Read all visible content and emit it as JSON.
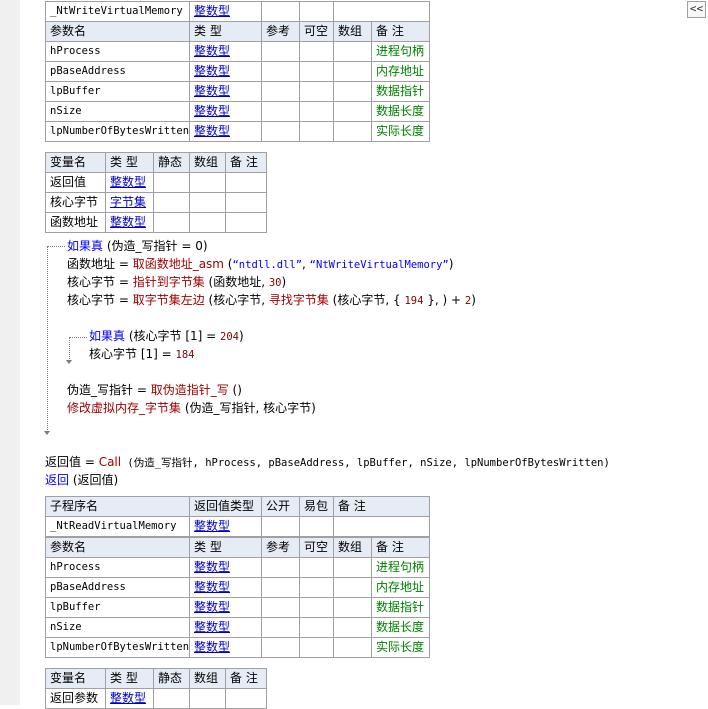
{
  "ui": {
    "collapse_glyph": "<<"
  },
  "sub1": {
    "name": "_NtWriteVirtualMemory",
    "ret_type": "整数型",
    "param_header": [
      "参数名",
      "类 型",
      "参考",
      "可空",
      "数组",
      "备 注"
    ],
    "params": [
      {
        "name": "hProcess",
        "type": "整数型",
        "note": "进程句柄"
      },
      {
        "name": "pBaseAddress",
        "type": "整数型",
        "note": "内存地址"
      },
      {
        "name": "lpBuffer",
        "type": "整数型",
        "note": "数据指针"
      },
      {
        "name": "nSize",
        "type": "整数型",
        "note": "数据长度"
      },
      {
        "name": "lpNumberOfBytesWritten",
        "type": "整数型",
        "note": "实际长度"
      }
    ],
    "var_header": [
      "变量名",
      "类 型",
      "静态",
      "数组",
      "备 注"
    ],
    "vars": [
      {
        "name": "返回值",
        "type": "整数型"
      },
      {
        "name": "核心字节",
        "type": "字节集"
      },
      {
        "name": "函数地址",
        "type": "整数型"
      }
    ],
    "code": {
      "if1_kw": "如果真",
      "if1_rest": " (伪造_写指针 = 0)",
      "l2_a": "函数地址 = ",
      "l2_fn": "取函数地址_asm",
      "l2_b": " (",
      "l2_s1": "“ntdll.dll”",
      "l2_c": ", ",
      "l2_s2": "“NtWriteVirtualMemory”",
      "l2_d": ")",
      "l3_a": "核心字节 = ",
      "l3_fn": "指针到字节集",
      "l3_b": " (函数地址, ",
      "l3_n": "30",
      "l3_c": ")",
      "l4_a": "核心字节 = ",
      "l4_fn": "取字节集左边",
      "l4_b": " (核心字节, ",
      "l4_fn2": "寻找字节集",
      "l4_c": " (核心字节, { ",
      "l4_n1": "194",
      "l4_d": " }, ) + ",
      "l4_n2": "2",
      "l4_e": ")",
      "if2_kw": "如果真",
      "if2_a": " (核心字节 [1] = ",
      "if2_n": "204",
      "if2_b": ")",
      "l6_a": "核心字节 [1] = ",
      "l6_n": "184",
      "l7_a": "伪造_写指针 = ",
      "l7_fn": "取伪造指针_写",
      "l7_b": " ()",
      "l8_fn": "修改虚拟内存_字节集",
      "l8_b": " (伪造_写指针, 核心字节)",
      "l9_a": "返回值 = ",
      "l9_fn": "Call",
      "l9_b": " (伪造_写指针, hProcess, pBaseAddress, lpBuffer, nSize, lpNumberOfBytesWritten)",
      "l10_kw": "返回",
      "l10_b": " (返回值)"
    }
  },
  "sub2": {
    "header": [
      "子程序名",
      "返回值类型",
      "公开",
      "易包",
      "备 注"
    ],
    "name": "_NtReadVirtualMemory",
    "ret_type": "整数型",
    "param_header": [
      "参数名",
      "类 型",
      "参考",
      "可空",
      "数组",
      "备 注"
    ],
    "params": [
      {
        "name": "hProcess",
        "type": "整数型",
        "note": "进程句柄"
      },
      {
        "name": "pBaseAddress",
        "type": "整数型",
        "note": "内存地址"
      },
      {
        "name": "lpBuffer",
        "type": "整数型",
        "note": "数据指针"
      },
      {
        "name": "nSize",
        "type": "整数型",
        "note": "数据长度"
      },
      {
        "name": "lpNumberOfBytesWritten",
        "type": "整数型",
        "note": "实际长度"
      }
    ],
    "var_header": [
      "变量名",
      "类 型",
      "静态",
      "数组",
      "备 注"
    ],
    "vars": [
      {
        "name": "返回参数",
        "type": "整数型"
      }
    ]
  }
}
